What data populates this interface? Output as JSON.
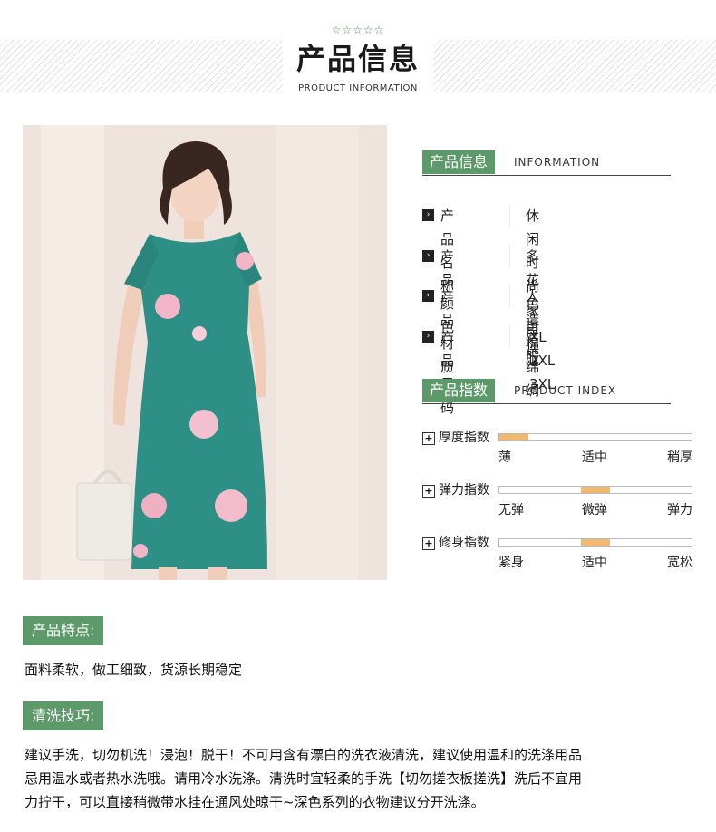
{
  "header": {
    "stars": "☆☆☆☆☆",
    "title": "产品信息",
    "subtitle": "PRODUCT INFORMATION"
  },
  "info": {
    "tag": "产品信息",
    "tag_en": "INFORMATION",
    "rows": [
      {
        "label": "产品名称",
        "value": "休闲时尚家居服"
      },
      {
        "label": "产品颜色",
        "value": "多花色可选"
      },
      {
        "label": "产品材质",
        "value": "人造棉 绵绸"
      },
      {
        "label": "产品尺码",
        "value": "XL 2XL 3XL"
      }
    ]
  },
  "index": {
    "tag": "产品指数",
    "tag_en": "PRODUCT INDEX",
    "items": [
      {
        "label": "厚度指数",
        "ticks": [
          "薄",
          "适中",
          "稍厚"
        ],
        "level": 0.0
      },
      {
        "label": "弹力指数",
        "ticks": [
          "无弹",
          "微弹",
          "弹力"
        ],
        "level": 0.5
      },
      {
        "label": "修身指数",
        "ticks": [
          "紧身",
          "适中",
          "宽松"
        ],
        "level": 0.5
      }
    ]
  },
  "features": {
    "tag": "产品特点:",
    "text": "面料柔软，做工细致，货源长期稳定"
  },
  "washing": {
    "tag": "清洗技巧:",
    "lines": [
      "建议手洗，切勿机洗！浸泡！脱干！不可用含有漂白的洗衣液清洗，建议使用温和的洗涤用品",
      "忌用温水或者热水洗哦。请用冷水洗涤。清洗时宜轻柔的手洗【切勿搓衣板搓洗】洗后不宜用",
      "力拧干，可以直接稍微带水挂在通风处晾干~深色系列的衣物建议分开洗涤。"
    ]
  },
  "colors": {
    "accent": "#5d9a6a",
    "bar_fill": "#f2b870",
    "dress": "#2e8f86"
  }
}
